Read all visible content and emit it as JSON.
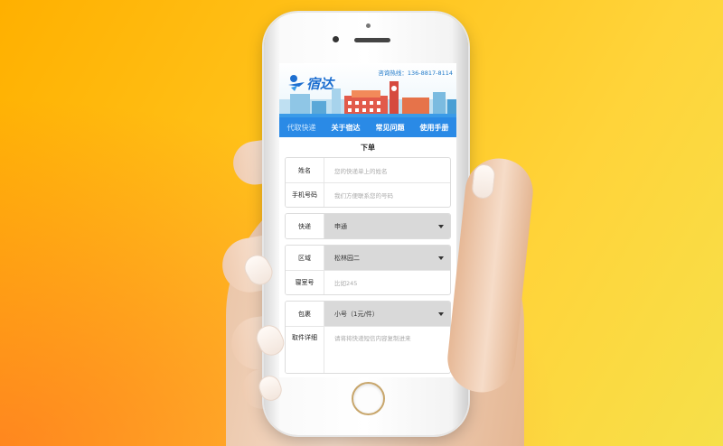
{
  "header": {
    "hotline": "咨询热线：136-8817-8114",
    "logo_text": "宿达"
  },
  "nav": {
    "items": [
      {
        "label": "代取快递"
      },
      {
        "label": "关于宿达"
      },
      {
        "label": "常见问题"
      },
      {
        "label": "使用手册"
      }
    ]
  },
  "form": {
    "title": "下单",
    "name": {
      "label": "姓名",
      "placeholder": "您的快递单上的姓名"
    },
    "phone": {
      "label": "手机号码",
      "placeholder": "我们方便联系您的号码"
    },
    "courier": {
      "label": "快递",
      "value": "申通"
    },
    "area": {
      "label": "区域",
      "value": "松林园二"
    },
    "room": {
      "label": "寝室号",
      "placeholder": "比如245"
    },
    "package": {
      "label": "包裹",
      "value": "小号（1元/件）"
    },
    "details": {
      "label": "取件详细",
      "placeholder": "请将将快递短信内容复制进来"
    }
  },
  "colors": {
    "nav": "#2a8ae6",
    "accent": "#1e78c8"
  }
}
